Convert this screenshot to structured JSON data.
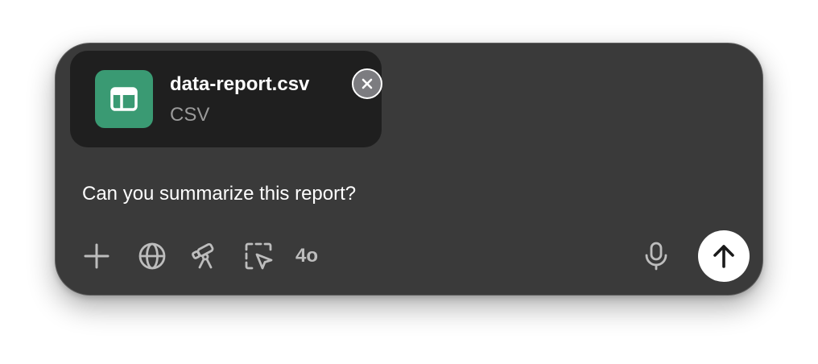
{
  "attachment": {
    "file_name": "data-report.csv",
    "file_type": "CSV",
    "icon": "table-icon",
    "icon_color": "#3a9a73",
    "remove_icon": "close-icon"
  },
  "composer": {
    "text": "Can you summarize this report?",
    "background_color": "#3a3a3a"
  },
  "toolbar": {
    "add_icon": "plus-icon",
    "search_icon": "globe-icon",
    "research_icon": "telescope-icon",
    "screen_select_icon": "select-cursor-icon",
    "model_label": "4o",
    "voice_icon": "microphone-icon",
    "send_icon": "arrow-up-icon"
  }
}
